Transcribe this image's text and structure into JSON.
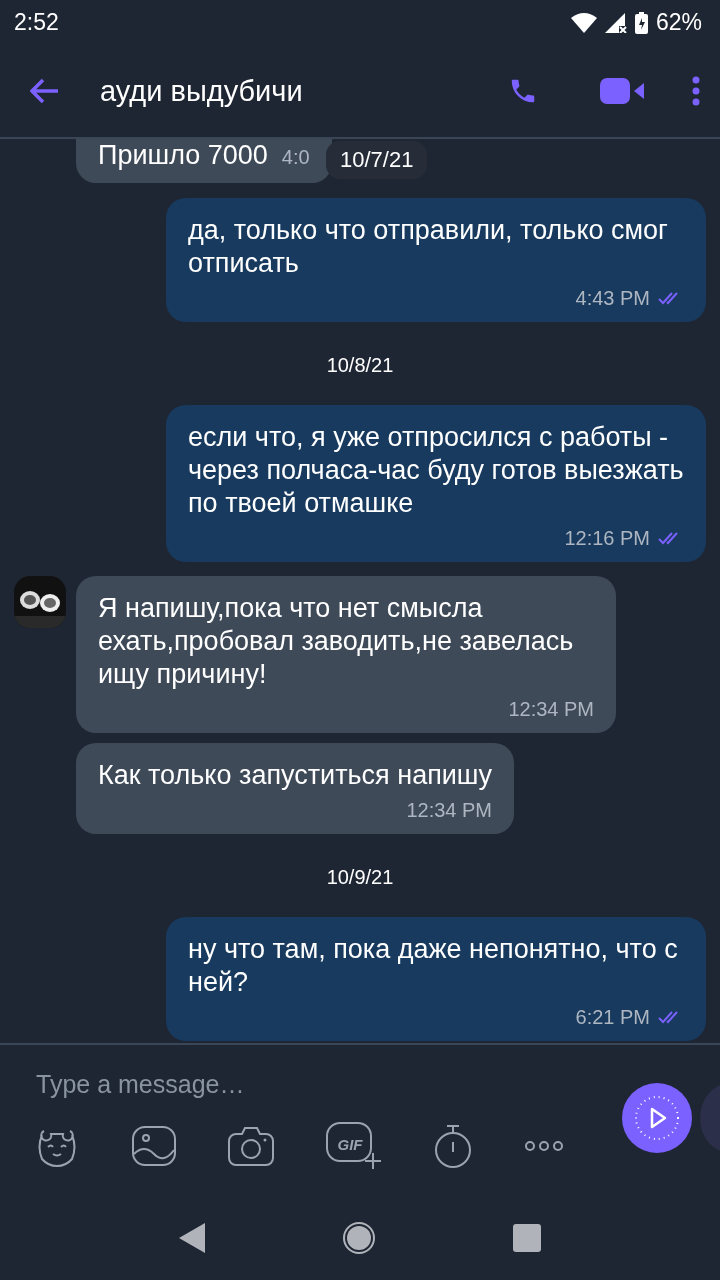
{
  "status_bar": {
    "time": "2:52",
    "battery": "62%"
  },
  "header": {
    "title": "ауди выдубичи"
  },
  "messages": [
    {
      "kind": "incoming",
      "text": "Пришло 7000",
      "time": "4:0",
      "avatar": false,
      "overlay_date": "10/7/21"
    },
    {
      "kind": "outgoing",
      "text": "да, только что отправили, только смог отписать",
      "time": "4:43 PM",
      "read": true
    },
    {
      "kind": "date",
      "text": "10/8/21"
    },
    {
      "kind": "outgoing",
      "text": "если что, я уже отпросился с работы - через полчаса-час буду готов выезжать по твоей отмашке",
      "time": "12:16 PM",
      "read": true
    },
    {
      "kind": "incoming",
      "text": "Я напишу,пока что нет смысла ехать,пробовал заводить,не завелась ищу причину!",
      "time": "12:34 PM",
      "avatar": true
    },
    {
      "kind": "incoming",
      "text": "Как только запуститься напишу",
      "time": "12:34 PM",
      "avatar": false
    },
    {
      "kind": "date",
      "text": "10/9/21"
    },
    {
      "kind": "outgoing",
      "text": "ну что там, пока даже непонятно, что с ней?",
      "time": "6:21 PM",
      "read": true
    }
  ],
  "composer": {
    "placeholder": "Type a message…",
    "gif_label": "GIF"
  }
}
